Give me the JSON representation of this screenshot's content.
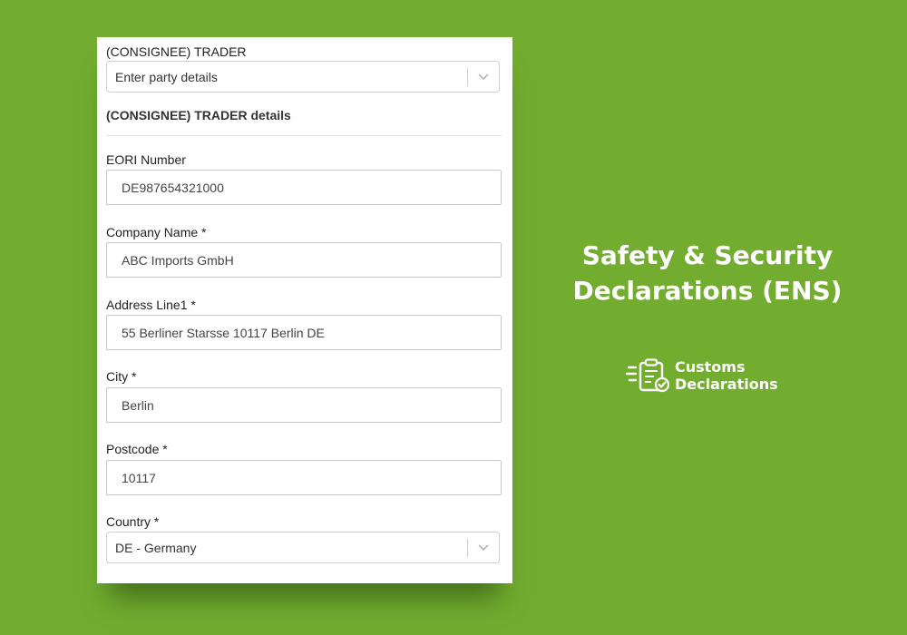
{
  "form": {
    "party_label": "(CONSIGNEE) TRADER",
    "party_select": {
      "value": "Enter party details",
      "icon": "chevron-down-icon"
    },
    "section_title": "(CONSIGNEE) TRADER details",
    "eori": {
      "label": "EORI Number",
      "value": "DE987654321000"
    },
    "company": {
      "label": "Company Name *",
      "value": "ABC Imports GmbH"
    },
    "address": {
      "label": "Address Line1 *",
      "value": "55 Berliner Starsse 10117 Berlin DE"
    },
    "city": {
      "label": "City *",
      "value": "Berlin"
    },
    "postcode": {
      "label": "Postcode *",
      "value": "10117"
    },
    "country": {
      "label": "Country *",
      "value": "DE - Germany",
      "icon": "chevron-down-icon"
    }
  },
  "promo": {
    "headline_line1": "Safety & Security",
    "headline_line2": "Declarations (ENS)",
    "logo_line1": "Customs",
    "logo_line2": "Declarations",
    "logo_icon": "clipboard-check-icon"
  },
  "colors": {
    "background": "#72ad30",
    "card": "#ffffff",
    "text": "#ffffff"
  }
}
